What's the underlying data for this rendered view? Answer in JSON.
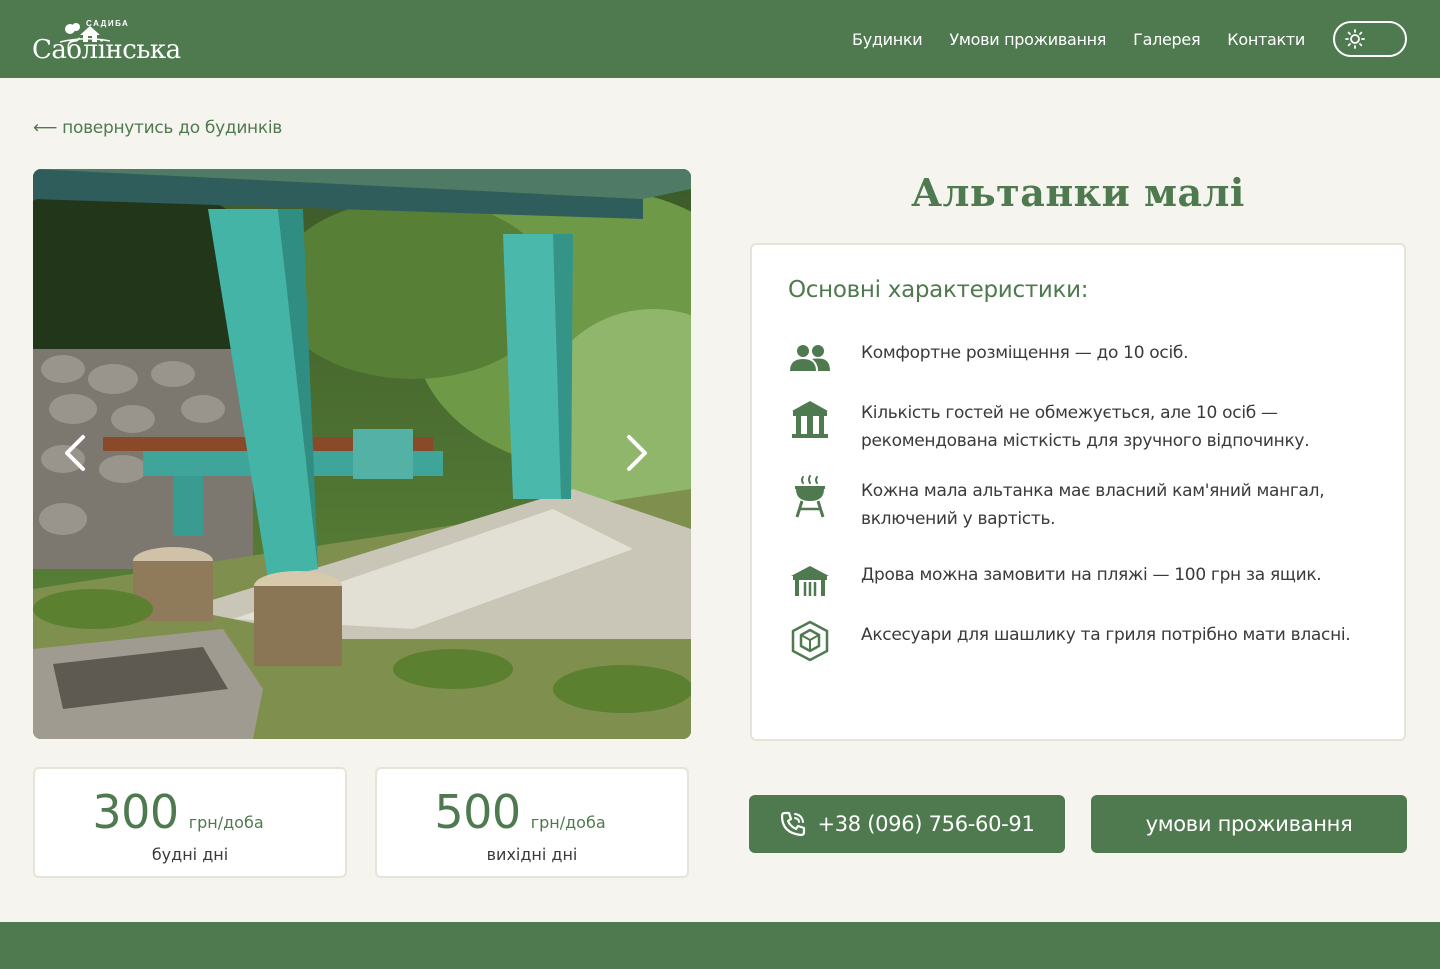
{
  "brand": {
    "small_label": "САДИБА",
    "name": "Саблінська"
  },
  "nav": {
    "items": [
      {
        "label": "Будинки"
      },
      {
        "label": "Умови проживання"
      },
      {
        "label": "Галерея"
      },
      {
        "label": "Контакти"
      }
    ],
    "theme_toggle_icon": "sun-icon"
  },
  "back_link": "⟵ повернутись до будинків",
  "title": "Альтанки малі",
  "features": {
    "heading": "Основні характеристики:",
    "items": [
      {
        "icon": "people-icon",
        "text": "Комфортне розміщення — до 10 осіб."
      },
      {
        "icon": "gazebo-icon",
        "text": "Кількість гостей не обмежується, але 10 осіб — рекомендована місткість для зручного відпочинку."
      },
      {
        "icon": "grill-icon",
        "text": "Кожна мала альтанка має власний кам'яний мангал, включений у вартість."
      },
      {
        "icon": "market-stall-icon",
        "text": "Дрова можна замовити на пляжі — 100 грн за ящик."
      },
      {
        "icon": "package-icon",
        "text": "Аксесуари для шашлику та гриля потрібно мати власні."
      }
    ]
  },
  "prices": [
    {
      "value": "300",
      "unit": "грн/доба",
      "note": "будні дні"
    },
    {
      "value": "500",
      "unit": "грн/доба",
      "note": "вихідні дні"
    }
  ],
  "buttons": {
    "phone": "+38 (096) 756-60-91",
    "terms": "умови проживання"
  },
  "colors": {
    "accent": "#4f7a4f",
    "background": "#f5f4ee",
    "card": "#ffffff"
  }
}
